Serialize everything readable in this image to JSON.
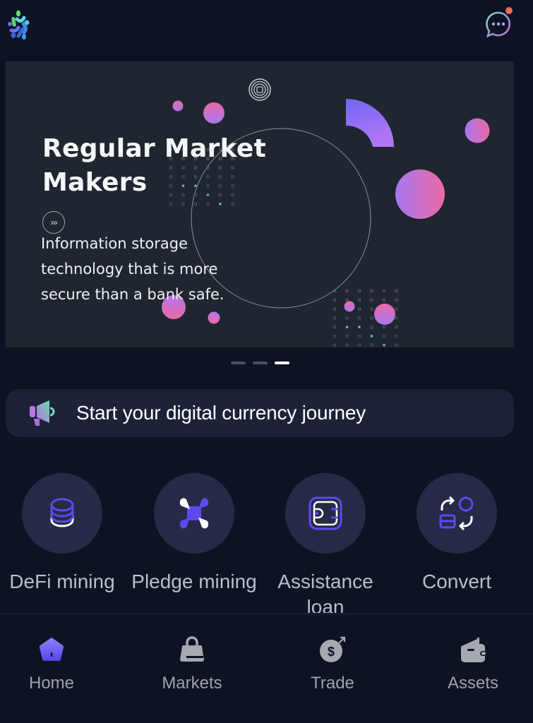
{
  "header": {
    "logo_icon": "colorful-people-star-logo",
    "chat_icon": "chat-bubble-with-notification-dot"
  },
  "banner": {
    "title": "Regular Market Makers",
    "arrow_label": "›››",
    "description": "Information storage technology that is more secure than a bank safe.",
    "slide_count": 3,
    "active_slide": 3
  },
  "carousel": {
    "indicators": [
      {
        "active": false
      },
      {
        "active": false
      },
      {
        "active": true
      }
    ]
  },
  "notice": {
    "icon": "megaphone-icon",
    "text": "Start your digital currency journey"
  },
  "features": [
    {
      "label": "DeFi mining",
      "icon": "coin-stack-icon"
    },
    {
      "label": "Pledge mining",
      "icon": "nodes-network-icon"
    },
    {
      "label": "Assistance loan",
      "icon": "wallet-card-icon"
    },
    {
      "label": "Convert",
      "icon": "exchange-icon"
    }
  ],
  "tabbar": {
    "items": [
      {
        "label": "Home",
        "icon": "home-icon",
        "active": true
      },
      {
        "label": "Markets",
        "icon": "bag-icon",
        "active": false
      },
      {
        "label": "Trade",
        "icon": "dollar-trade-icon",
        "active": false
      },
      {
        "label": "Assets",
        "icon": "wallet-icon",
        "active": false
      }
    ]
  },
  "colors": {
    "background": "#0e1324",
    "banner_bg": "#20262f",
    "card_bg": "#1e2238",
    "feature_circle": "#262a46",
    "accent": "#5b4af0",
    "gradient_pink": "#e96aa6",
    "gradient_purple": "#a574f0",
    "notification_dot": "#ec6b5c",
    "tab_inactive": "#9ea1ab"
  }
}
